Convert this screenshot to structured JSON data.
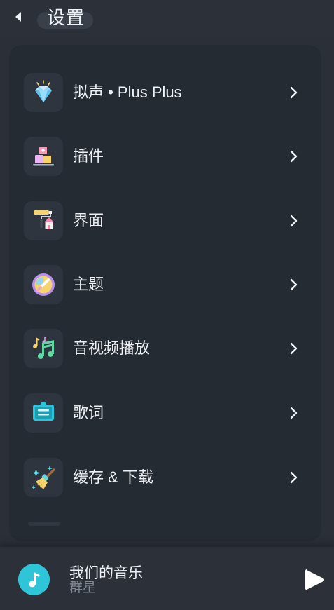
{
  "header": {
    "title": "设置"
  },
  "menu": {
    "items": [
      {
        "label": "拟声 • Plus Plus",
        "icon": "diamond-icon"
      },
      {
        "label": "插件",
        "icon": "blocks-icon"
      },
      {
        "label": "界面",
        "icon": "paint-roller-house-icon"
      },
      {
        "label": "主题",
        "icon": "palette-icon"
      },
      {
        "label": "音视频播放",
        "icon": "music-notes-icon"
      },
      {
        "label": "歌词",
        "icon": "lyrics-screen-icon"
      },
      {
        "label": "缓存 & 下载",
        "icon": "broom-icon"
      }
    ]
  },
  "player": {
    "title": "我们的音乐",
    "artist": "群星",
    "avatar_icon": "music-note-icon",
    "play_icon": "play-icon"
  },
  "colors": {
    "background": "#2a2f38",
    "card": "#252b33",
    "icon_tile": "#2f353f",
    "accent_cyan": "#2ec5d8"
  }
}
